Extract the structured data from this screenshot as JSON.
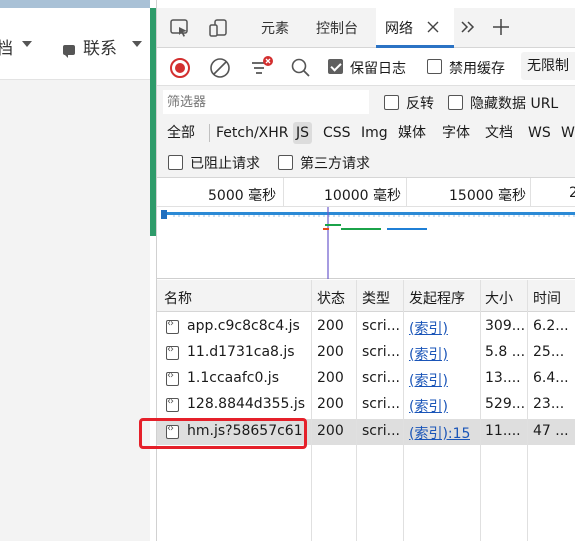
{
  "left_page": {
    "nav_partial": "档",
    "nav_contact": "联系"
  },
  "devtools": {
    "tabs": [
      {
        "label": "元素"
      },
      {
        "label": "控制台"
      },
      {
        "label": "网络"
      }
    ],
    "toolbar": {
      "preserve_log": "保留日志",
      "preserve_log_checked": true,
      "disable_cache": "禁用缓存",
      "disable_cache_checked": false,
      "throttle": "无限制"
    },
    "filter": {
      "placeholder": "筛选器",
      "invert": "反转",
      "hide_data_url": "隐藏数据 URL"
    },
    "types": [
      "全部",
      "Fetch/XHR",
      "JS",
      "CSS",
      "Img",
      "媒体",
      "字体",
      "文档",
      "WS",
      "W"
    ],
    "active_type": "JS",
    "block_row": {
      "blocked": "已阻止请求",
      "third_party": "第三方请求"
    },
    "timeline": {
      "ticks": [
        "5000  毫秒",
        "10000  毫秒",
        "15000  毫秒",
        "2"
      ]
    },
    "table": {
      "headers": [
        "名称",
        "状态",
        "类型",
        "发起程序",
        "大小",
        "时间"
      ],
      "rows": [
        {
          "name": "app.c9c8c8c4.js",
          "status": "200",
          "type": "scri...",
          "initiator": "(索引)",
          "size": "309...",
          "time": "6.2..."
        },
        {
          "name": "11.d1731ca8.js",
          "status": "200",
          "type": "scri...",
          "initiator": "(索引)",
          "size": "5.8 ...",
          "time": "25..."
        },
        {
          "name": "1.1ccaafc0.js",
          "status": "200",
          "type": "scri...",
          "initiator": "(索引)",
          "size": "13....",
          "time": "6.4..."
        },
        {
          "name": "128.8844d355.js",
          "status": "200",
          "type": "scri...",
          "initiator": "(索引)",
          "size": "529...",
          "time": "23..."
        },
        {
          "name": "hm.js?58657c61...",
          "status": "200",
          "type": "scri...",
          "initiator": "(索引):15",
          "size": "11....",
          "time": "47 ..."
        }
      ]
    }
  },
  "colors": {
    "accent": "#2b73c4",
    "record_red": "#d32f2f",
    "highlight": "#e5202a",
    "splitter_green": "#2e9b6a"
  }
}
